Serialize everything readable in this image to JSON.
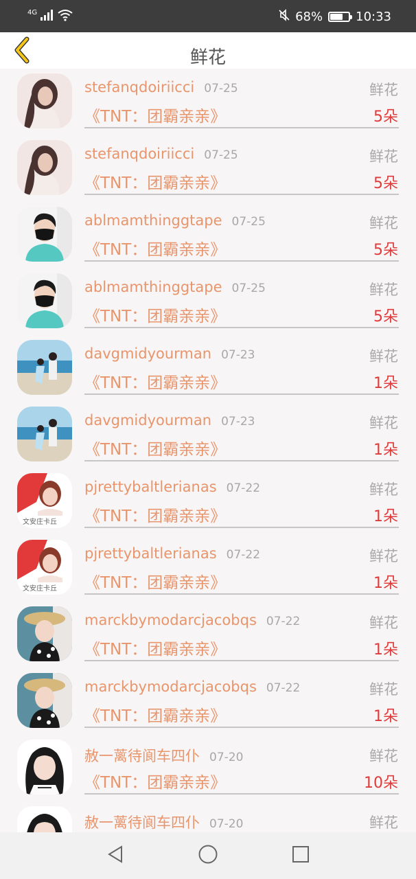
{
  "status_bar": {
    "network": "4G",
    "battery_percent": "68%",
    "battery_level": 0.68,
    "time": "10:33",
    "icons": [
      "signal-icon",
      "wifi-icon",
      "mute-icon",
      "battery-icon"
    ]
  },
  "header": {
    "back_icon": "back-chevron-icon",
    "title": "鲜花"
  },
  "colors": {
    "accent": "#e9956c",
    "count": "#e13a3a",
    "muted": "#a8a8a8",
    "back_arrow": "#f5c518",
    "status_bar_bg": "#3d3d3d"
  },
  "records": [
    {
      "username": "stefanqdoiriicci",
      "date": "07-25",
      "type": "鲜花",
      "work": "《TNT：团霸亲亲》",
      "count": "5朵",
      "avatar": "woman-portrait"
    },
    {
      "username": "stefanqdoiriicci",
      "date": "07-25",
      "type": "鲜花",
      "work": "《TNT：团霸亲亲》",
      "count": "5朵",
      "avatar": "woman-portrait"
    },
    {
      "username": "ablmamthinggtape",
      "date": "07-25",
      "type": "鲜花",
      "work": "《TNT：团霸亲亲》",
      "count": "5朵",
      "avatar": "masked-man"
    },
    {
      "username": "ablmamthinggtape",
      "date": "07-25",
      "type": "鲜花",
      "work": "《TNT：团霸亲亲》",
      "count": "5朵",
      "avatar": "masked-man"
    },
    {
      "username": "davgmidyourman",
      "date": "07-23",
      "type": "鲜花",
      "work": "《TNT：团霸亲亲》",
      "count": "1朵",
      "avatar": "beach-couple"
    },
    {
      "username": "davgmidyourman",
      "date": "07-23",
      "type": "鲜花",
      "work": "《TNT：团霸亲亲》",
      "count": "1朵",
      "avatar": "beach-couple"
    },
    {
      "username": "pjrettybaltlerianas",
      "date": "07-22",
      "type": "鲜花",
      "work": "《TNT：团霸亲亲》",
      "count": "1朵",
      "avatar": "woman-red"
    },
    {
      "username": "pjrettybaltlerianas",
      "date": "07-22",
      "type": "鲜花",
      "work": "《TNT：团霸亲亲》",
      "count": "1朵",
      "avatar": "woman-red"
    },
    {
      "username": "marckbymodarcjacobqs",
      "date": "07-22",
      "type": "鲜花",
      "work": "《TNT：团霸亲亲》",
      "count": "1朵",
      "avatar": "girl-hat"
    },
    {
      "username": "marckbymodarcjacobqs",
      "date": "07-22",
      "type": "鲜花",
      "work": "《TNT：团霸亲亲》",
      "count": "1朵",
      "avatar": "girl-hat"
    },
    {
      "username": "赦一蓠待阆车四仆",
      "date": "07-20",
      "type": "鲜花",
      "work": "《TNT：团霸亲亲》",
      "count": "10朵",
      "avatar": "child-dark"
    },
    {
      "username": "赦一蓠待阆车四仆",
      "date": "07-20",
      "type": "鲜花",
      "work": "",
      "count": "",
      "avatar": "child-dark"
    }
  ],
  "nav_bar": {
    "icons": [
      "back-triangle-icon",
      "home-circle-icon",
      "recents-square-icon"
    ]
  }
}
